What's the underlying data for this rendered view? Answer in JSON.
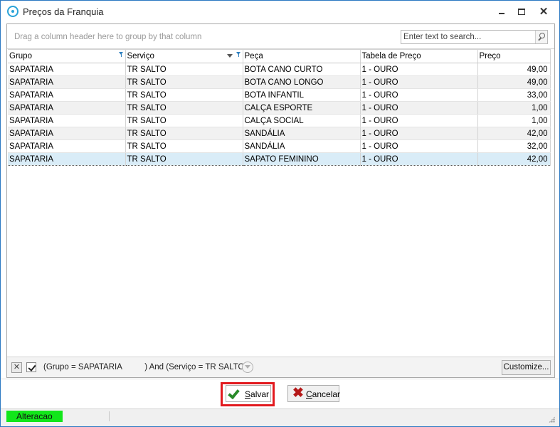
{
  "window": {
    "title": "Preços da Franquia"
  },
  "grid": {
    "group_hint": "Drag a column header here to group by that column",
    "search_placeholder": "Enter text to search...",
    "columns": [
      "Grupo",
      "Serviço",
      "Peça",
      "Tabela de Preço",
      "Preço"
    ],
    "rows": [
      {
        "grupo": "SAPATARIA",
        "servico": "TR SALTO",
        "peca": "BOTA CANO CURTO",
        "tabela": "1 - OURO",
        "preco": "49,00"
      },
      {
        "grupo": "SAPATARIA",
        "servico": "TR SALTO",
        "peca": "BOTA CANO LONGO",
        "tabela": "1 - OURO",
        "preco": "49,00"
      },
      {
        "grupo": "SAPATARIA",
        "servico": "TR SALTO",
        "peca": "BOTA INFANTIL",
        "tabela": "1 - OURO",
        "preco": "33,00"
      },
      {
        "grupo": "SAPATARIA",
        "servico": "TR SALTO",
        "peca": "CALÇA ESPORTE",
        "tabela": "1 - OURO",
        "preco": "1,00"
      },
      {
        "grupo": "SAPATARIA",
        "servico": "TR SALTO",
        "peca": "CALÇA SOCIAL",
        "tabela": "1 - OURO",
        "preco": "1,00"
      },
      {
        "grupo": "SAPATARIA",
        "servico": "TR SALTO",
        "peca": "SANDÁLIA",
        "tabela": "1 - OURO",
        "preco": "42,00"
      },
      {
        "grupo": "SAPATARIA",
        "servico": "TR SALTO",
        "peca": "SANDÁLIA",
        "tabela": "1 - OURO",
        "preco": "32,00"
      },
      {
        "grupo": "SAPATARIA",
        "servico": "TR SALTO",
        "peca": "SAPATO FEMININO",
        "tabela": "1 - OURO",
        "preco": "42,00"
      }
    ],
    "selected_row_index": 7,
    "filter_text": "(Grupo = SAPATARIA          ) And (Serviço = TR SALTO)",
    "filter_enabled": true,
    "customize_label": "Customize..."
  },
  "footer": {
    "save_label_u": "S",
    "save_label_rest": "alvar",
    "cancel_label_u": "C",
    "cancel_label_rest": "ancelar"
  },
  "status": {
    "mode_label": "Alteracao",
    "mode_color": "#12e61a"
  }
}
